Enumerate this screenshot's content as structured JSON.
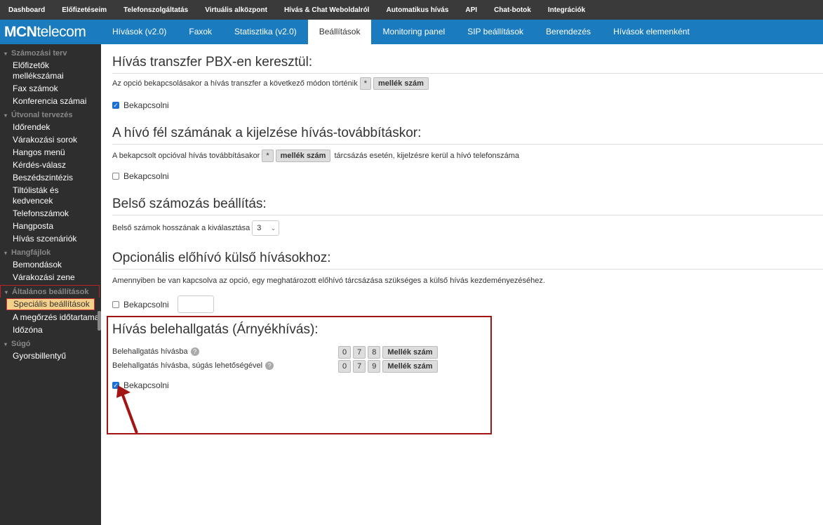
{
  "topbar": {
    "items": [
      "Dashboard",
      "Előfizetéseim",
      "Telefonszolgáltatás",
      "Virtuális alközpont",
      "Hívás & Chat Weboldalról",
      "Automatikus hívás",
      "API",
      "Chat-botok",
      "Integrációk"
    ]
  },
  "logo": {
    "bold": "MCN",
    "rest": "telecom"
  },
  "tabs": [
    "Hívások (v2.0)",
    "Faxok",
    "Statisztika (v2.0)",
    "Beállítások",
    "Monitoring panel",
    "SIP beállítások",
    "Berendezés",
    "Hívások elemenként"
  ],
  "active_tab": "Beállítások",
  "sidebar": {
    "sections": [
      {
        "title": "Számozási terv",
        "items": [
          "Előfizetők mellékszámai",
          "Fax számok",
          "Konferencia számai"
        ]
      },
      {
        "title": "Útvonal tervezés",
        "items": [
          "Időrendek",
          "Várakozási sorok",
          "Hangos menü",
          "Kérdés-válasz",
          "Beszédszintézis",
          "Tiltólisták és kedvencek",
          "Telefonszámok",
          "Hangposta",
          "Hívás szcenáriók"
        ]
      },
      {
        "title": "Hangfájlok",
        "items": [
          "Bemondások",
          "Várakozási zene"
        ]
      },
      {
        "title": "Általános beállítások",
        "items": [
          "Speciális beállítások",
          "A megőrzés időtartama",
          "Időzóna"
        ]
      },
      {
        "title": "Súgó",
        "items": [
          "Gyorsbillentyű"
        ]
      }
    ],
    "selected": "Speciális beállítások"
  },
  "sec1": {
    "title": "Hívás transzfer PBX-en keresztül:",
    "desc": "Az opció bekapcsolásakor a hívás transzfer a következő módon történik",
    "star": "*",
    "btn": "mellék szám",
    "checkbox": "Bekapcsolni"
  },
  "sec2": {
    "title": "A hívó fél számának a kijelzése hívás-továbbításkor:",
    "desc": "A bekapcsolt opcióval hívás továbbításakor",
    "star": "*",
    "btn": "mellék szám",
    "desc2": "tárcsázás esetén, kijelzésre kerül a hívó telefonszáma",
    "checkbox": "Bekapcsolni"
  },
  "sec3": {
    "title": "Belső számozás beállítás:",
    "desc": "Belső számok hosszának a kiválasztása",
    "select_value": "3"
  },
  "sec4": {
    "title": "Opcionális előhívó külső hívásokhoz:",
    "desc": "Amennyiben be van kapcsolva az opció, egy meghatározott előhívó tárcsázása szükséges a külső hívás kezdeményezéséhez.",
    "checkbox": "Bekapcsolni"
  },
  "sec5": {
    "title": "Hívás belehallgatás (Árnyékhívás):",
    "row1_label": "Belehallgatás hívásba",
    "row1_keys": [
      "0",
      "7",
      "8"
    ],
    "row2_label": "Belehallgatás hívásba, súgás lehetőségével",
    "row2_keys": [
      "0",
      "7",
      "9"
    ],
    "btn": "Mellék szám",
    "help": "?",
    "checkbox": "Bekapcsolni"
  },
  "colors": {
    "topbar": "#3a3a3a",
    "navbar": "#1a7bbf",
    "sidebar": "#2e2e2e",
    "highlight": "#a31515",
    "selected_item": "#f5d08a"
  }
}
